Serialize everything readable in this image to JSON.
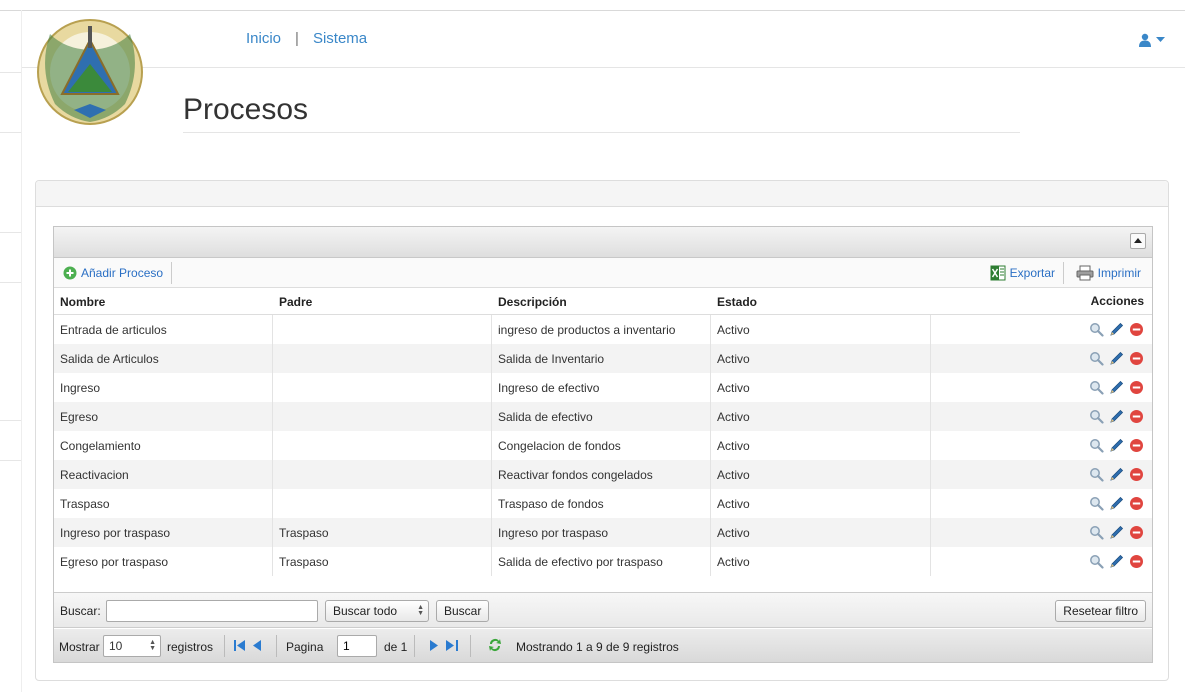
{
  "nav": {
    "home": "Inicio",
    "separator": "|",
    "system": "Sistema"
  },
  "page": {
    "title": "Procesos"
  },
  "toolbar": {
    "add": "Añadir Proceso",
    "export": "Exportar",
    "print": "Imprimir"
  },
  "table": {
    "headers": [
      "Nombre",
      "Padre",
      "Descripción",
      "Estado",
      "Acciones"
    ],
    "rows": [
      [
        "Entrada de articulos",
        "",
        "ingreso de productos a inventario",
        "Activo"
      ],
      [
        "Salida de Articulos",
        "",
        "Salida de Inventario",
        "Activo"
      ],
      [
        "Ingreso",
        "",
        "Ingreso de efectivo",
        "Activo"
      ],
      [
        "Egreso",
        "",
        "Salida de efectivo",
        "Activo"
      ],
      [
        "Congelamiento",
        "",
        "Congelacion de fondos",
        "Activo"
      ],
      [
        "Reactivacion",
        "",
        "Reactivar fondos congelados",
        "Activo"
      ],
      [
        "Traspaso",
        "",
        "Traspaso de fondos",
        "Activo"
      ],
      [
        "Ingreso por traspaso",
        "Traspaso",
        "Ingreso por traspaso",
        "Activo"
      ],
      [
        "Egreso por traspaso",
        "Traspaso",
        "Salida de efectivo por traspaso",
        "Activo"
      ]
    ]
  },
  "search": {
    "label": "Buscar:",
    "value": "",
    "scope": "Buscar todo",
    "button": "Buscar",
    "reset": "Resetear filtro"
  },
  "pager": {
    "show": "Mostrar",
    "page_size": "10",
    "records": "registros",
    "page_label": "Pagina",
    "page": "1",
    "of": "de 1",
    "summary": "Mostrando 1 a 9 de 9 registros"
  },
  "colors": {
    "link": "#3a87c8",
    "delete": "#e0453f"
  }
}
